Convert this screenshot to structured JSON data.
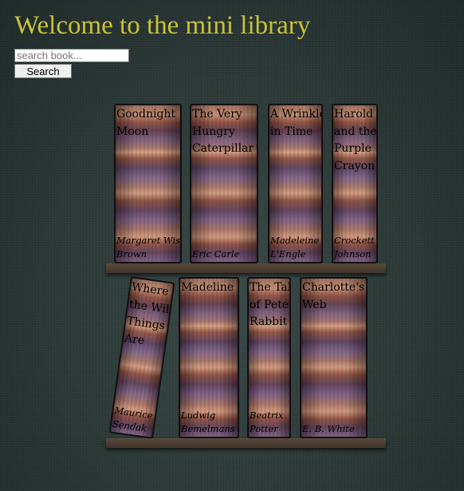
{
  "header": {
    "title": "Welcome to the mini library"
  },
  "search": {
    "placeholder": "search book...",
    "value": "",
    "button_label": "Search"
  },
  "shelves": [
    {
      "books": [
        {
          "title": "Goodnight Moon",
          "author": "Margaret Wise Brown"
        },
        {
          "title": "The Very Hungry Caterpillar",
          "author": "Eric Carle"
        },
        {
          "title": "A Wrinkle in Time",
          "author": "Madeleine L'Engle"
        },
        {
          "title": "Harold and the Purple Crayon",
          "author": "Crockett Johnson"
        }
      ]
    },
    {
      "books": [
        {
          "title": "Where the Wild Things Are",
          "author": "Maurice Sendak"
        },
        {
          "title": "Madeline",
          "author": "Ludwig Bemelmans"
        },
        {
          "title": "The Tale of Peter Rabbit",
          "author": "Beatrix Potter"
        },
        {
          "title": "Charlotte's Web",
          "author": "E. B. White"
        }
      ]
    }
  ],
  "colors": {
    "title": "#c9c338",
    "background": "#2b3836",
    "shelf": "#4d3f33"
  }
}
